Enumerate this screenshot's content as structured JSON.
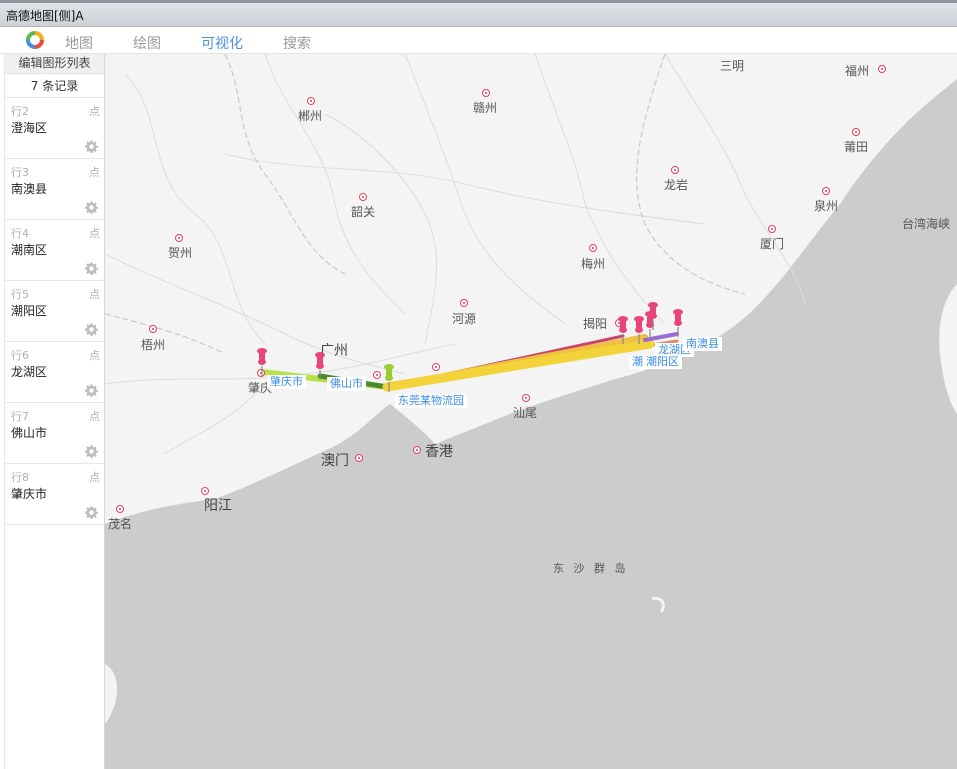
{
  "window": {
    "title": "高德地图[侧]A"
  },
  "toolbar": {
    "tabs": [
      {
        "label": "地图"
      },
      {
        "label": "绘图"
      },
      {
        "label": "可视化"
      },
      {
        "label": "搜索"
      }
    ],
    "active_tab": "可视化"
  },
  "sidebar": {
    "header": "编辑图形列表",
    "record_count": "7 条记录",
    "records": [
      {
        "row": "行2",
        "type": "点",
        "name": "澄海区"
      },
      {
        "row": "行3",
        "type": "点",
        "name": "南澳县"
      },
      {
        "row": "行4",
        "type": "点",
        "name": "潮南区"
      },
      {
        "row": "行5",
        "type": "点",
        "name": "潮阳区"
      },
      {
        "row": "行6",
        "type": "点",
        "name": "龙湖区"
      },
      {
        "row": "行7",
        "type": "点",
        "name": "佛山市"
      },
      {
        "row": "行8",
        "type": "点",
        "name": "肇庆市"
      }
    ]
  },
  "map": {
    "cities": [
      "三明",
      "福州",
      "郴州",
      "赣州",
      "莆田",
      "龙岩",
      "泉州",
      "韶关",
      "台湾海峡",
      "厦门",
      "贺州",
      "梅州",
      "河源",
      "揭阳",
      "梧州",
      "广州",
      "肇庆",
      "汕尾",
      "澳门",
      "香港",
      "阳江",
      "茂名"
    ],
    "sea_label": "东 沙 群 岛",
    "point_labels": [
      "肇庆市",
      "佛山市",
      "东莞某物流园",
      "龙湖区",
      "潮阳区",
      "南澳县",
      "潮"
    ],
    "colors": {
      "active_tab": "#4a90d9",
      "label_text": "#3a8ee0",
      "pin": "#e8457a",
      "origin_pin": "#9acd32",
      "city_dot": "#e0405a",
      "sea": "#cccccc",
      "land": "#f4f4f4"
    }
  }
}
